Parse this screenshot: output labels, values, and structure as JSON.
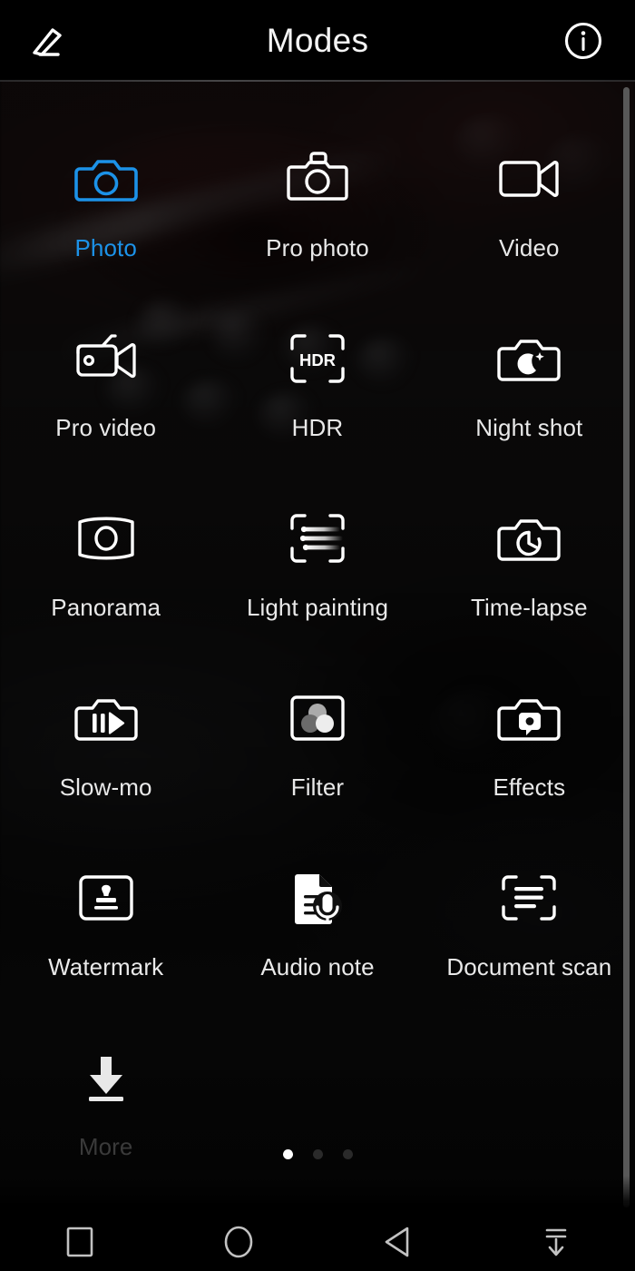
{
  "header": {
    "title": "Modes",
    "edit_icon": "pencil-icon",
    "info_icon": "info-icon"
  },
  "accent_color": "#1c92e8",
  "modes": [
    {
      "label": "Photo",
      "icon": "camera-icon",
      "selected": true
    },
    {
      "label": "Pro photo",
      "icon": "slr-camera-icon",
      "selected": false
    },
    {
      "label": "Video",
      "icon": "video-camera-icon",
      "selected": false
    },
    {
      "label": "Pro video",
      "icon": "pro-video-camera-icon",
      "selected": false
    },
    {
      "label": "HDR",
      "icon": "hdr-frame-icon",
      "selected": false
    },
    {
      "label": "Night shot",
      "icon": "camera-moon-icon",
      "selected": false
    },
    {
      "label": "Panorama",
      "icon": "panorama-icon",
      "selected": false
    },
    {
      "label": "Light painting",
      "icon": "light-trails-icon",
      "selected": false
    },
    {
      "label": "Time-lapse",
      "icon": "camera-timer-icon",
      "selected": false
    },
    {
      "label": "Slow-mo",
      "icon": "camera-play-icon",
      "selected": false
    },
    {
      "label": "Filter",
      "icon": "color-circles-icon",
      "selected": false
    },
    {
      "label": "Effects",
      "icon": "camera-bubble-icon",
      "selected": false
    },
    {
      "label": "Watermark",
      "icon": "stamp-card-icon",
      "selected": false
    },
    {
      "label": "Audio note",
      "icon": "document-mic-icon",
      "selected": false
    },
    {
      "label": "Document scan",
      "icon": "scan-lines-icon",
      "selected": false
    },
    {
      "label": "More",
      "icon": "download-icon",
      "selected": false
    }
  ],
  "hdr_badge_text": "HDR",
  "pagination": {
    "total": 3,
    "active_index": 0
  },
  "navbar": {
    "recents_label": "recents-square",
    "home_label": "home-circle",
    "back_label": "back-triangle",
    "hide_label": "hide-navbar"
  }
}
